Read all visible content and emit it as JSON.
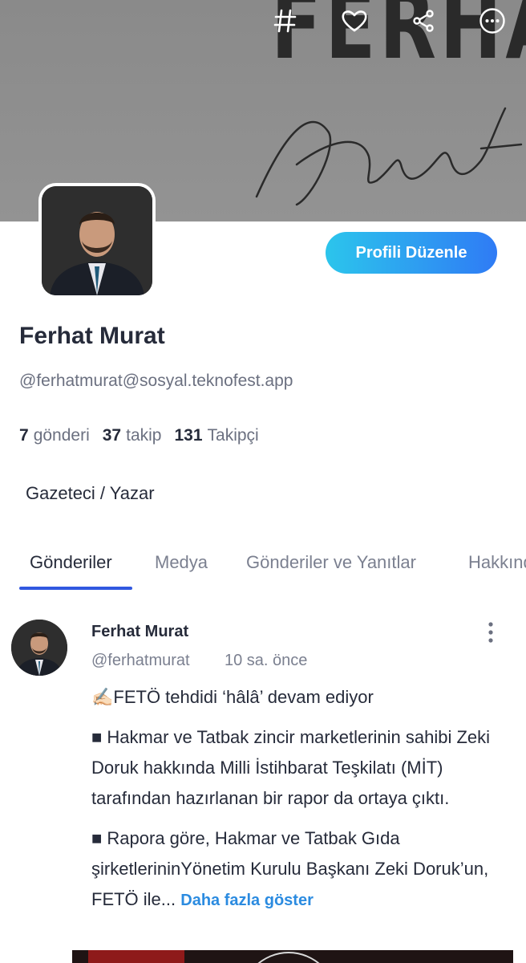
{
  "cover": {
    "brand_top": "FERHAT",
    "brand_script": "Murat"
  },
  "top_actions": [
    {
      "icon": "hashtag-icon"
    },
    {
      "icon": "heart-icon"
    },
    {
      "icon": "share-icon"
    },
    {
      "icon": "more-circle-icon"
    }
  ],
  "profile": {
    "edit_label": "Profili Düzenle",
    "name": "Ferhat Murat",
    "handle": "@ferhatmurat@sosyal.teknofest.app",
    "bio": "Gazeteci / Yazar",
    "stats": {
      "posts_count": "7",
      "posts_label": "gönderi",
      "following_count": "37",
      "following_label": "takip",
      "followers_count": "131",
      "followers_label": "Takipçi"
    }
  },
  "tabs": [
    {
      "label": "Gönderiler",
      "active": true
    },
    {
      "label": "Medya",
      "active": false
    },
    {
      "label": "Gönderiler ve Yanıtlar",
      "active": false
    },
    {
      "label": "Hakkında",
      "active": false
    }
  ],
  "post": {
    "author": "Ferhat Murat",
    "handle": "@ferhatmurat",
    "time": "10 sa. önce",
    "paragraph1": "✍🏻FETÖ tehdidi ‘hâlâ’ devam ediyor",
    "paragraph2": "■ Hakmar ve Tatbak zincir marketlerinin sahibi Zeki Doruk hakkında Milli İstihbarat Teşkilatı (MİT) tarafından hazırlanan bir rapor da ortaya çıktı.",
    "paragraph3": "■ Rapora göre, Hakmar ve Tatbak Gıda şirketlerininYönetim Kurulu Başkanı Zeki Doruk’un, FETÖ ile...",
    "show_more": "Daha fazla göster"
  },
  "colors": {
    "accent": "#3158e0",
    "button_gradient_start": "#2cc5ec",
    "button_gradient_end": "#2f7bf5",
    "link": "#2b8be0"
  }
}
